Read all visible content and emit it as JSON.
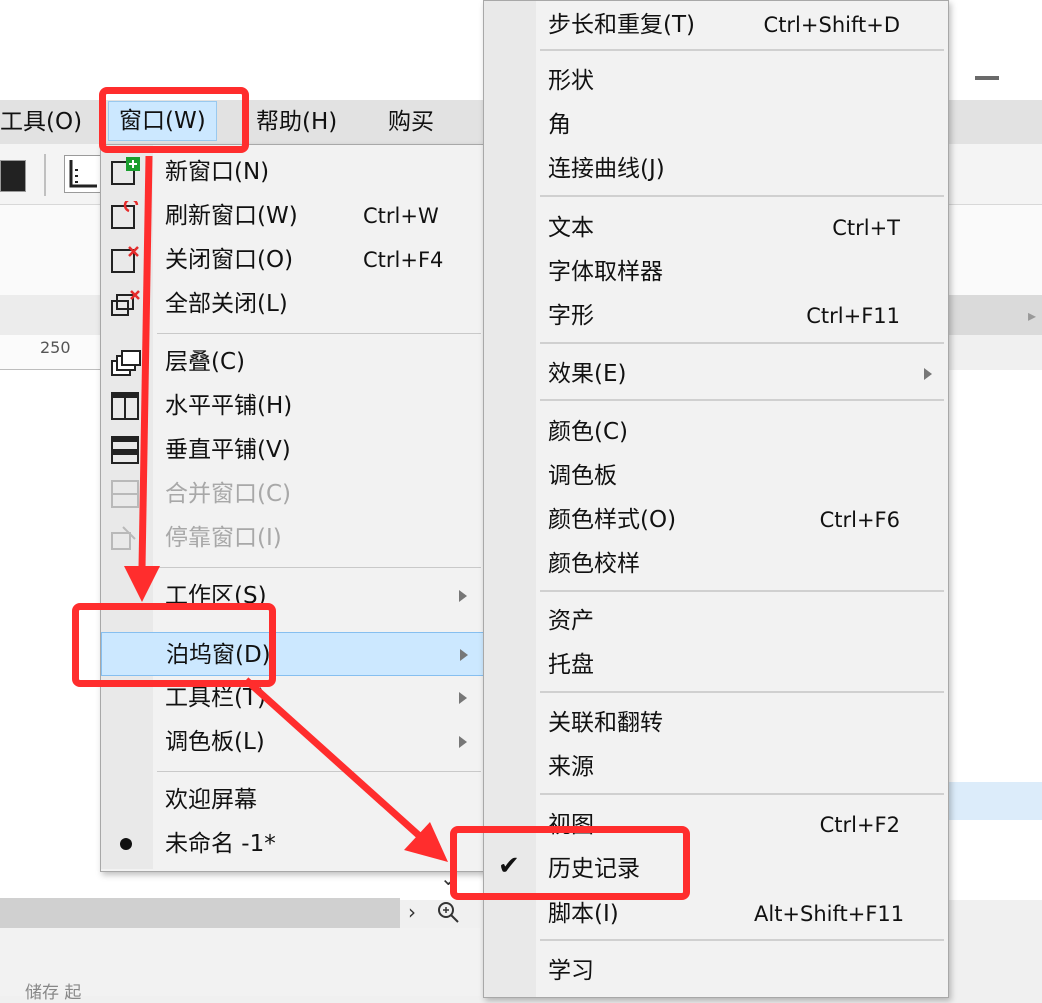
{
  "menubar": {
    "tools": "工具(O)",
    "window": "窗口(W)",
    "help": "帮助(H)",
    "buy": "购买"
  },
  "ruler": {
    "mark": "250"
  },
  "window_menu": {
    "new_window": {
      "label": "新窗口(N)",
      "shortcut": ""
    },
    "refresh_window": {
      "label": "刷新窗口(W)",
      "shortcut": "Ctrl+W"
    },
    "close_window": {
      "label": "关闭窗口(O)",
      "shortcut": "Ctrl+F4"
    },
    "close_all": {
      "label": "全部关闭(L)",
      "shortcut": ""
    },
    "cascade": {
      "label": "层叠(C)"
    },
    "tile_horizontal": {
      "label": "水平平铺(H)"
    },
    "tile_vertical": {
      "label": "垂直平铺(V)"
    },
    "combine_windows": {
      "label": "合并窗口(C)"
    },
    "dock_windows": {
      "label": "停靠窗口(I)"
    },
    "workspace": {
      "label": "工作区(S)"
    },
    "dockers": {
      "label": "泊坞窗(D)"
    },
    "toolbars": {
      "label": "工具栏(T)"
    },
    "palettes": {
      "label": "调色板(L)"
    },
    "welcome_screen": {
      "label": "欢迎屏幕"
    },
    "untitled_doc": {
      "label": "未命名 -1*"
    }
  },
  "docker_menu": [
    {
      "label": "步长和重复(T)",
      "shortcut": "Ctrl+Shift+D"
    },
    {
      "label": "形状",
      "shortcut": ""
    },
    {
      "label": "角",
      "shortcut": ""
    },
    {
      "label": "连接曲线(J)",
      "shortcut": ""
    },
    {
      "label": "文本",
      "shortcut": "Ctrl+T"
    },
    {
      "label": "字体取样器",
      "shortcut": ""
    },
    {
      "label": "字形",
      "shortcut": "Ctrl+F11"
    },
    {
      "label": "效果(E)",
      "shortcut": ""
    },
    {
      "label": "颜色(C)",
      "shortcut": ""
    },
    {
      "label": "调色板",
      "shortcut": ""
    },
    {
      "label": "颜色样式(O)",
      "shortcut": "Ctrl+F6"
    },
    {
      "label": "颜色校样",
      "shortcut": ""
    },
    {
      "label": "资产",
      "shortcut": ""
    },
    {
      "label": "托盘",
      "shortcut": ""
    },
    {
      "label": "关联和翻转",
      "shortcut": ""
    },
    {
      "label": "来源",
      "shortcut": ""
    },
    {
      "label": "视图",
      "shortcut": "Ctrl+F2"
    },
    {
      "label": "历史记录",
      "shortcut": "",
      "checked": true
    },
    {
      "label": "脚本(I)",
      "shortcut": "Alt+Shift+F11"
    },
    {
      "label": "学习",
      "shortcut": ""
    }
  ],
  "status": {
    "text": "储存 起"
  },
  "colors": {
    "highlight": "#cce8ff",
    "annotation_red": "#ff2d2d",
    "menu_bg": "#f2f2f2"
  },
  "icons": [
    "new-window-icon",
    "refresh-window-icon",
    "close-window-icon",
    "close-all-icon",
    "cascade-icon",
    "tile-horizontal-icon",
    "tile-vertical-icon",
    "combine-icon",
    "dock-icon",
    "checkmark-icon",
    "zoom-icon",
    "minimize-icon"
  ]
}
